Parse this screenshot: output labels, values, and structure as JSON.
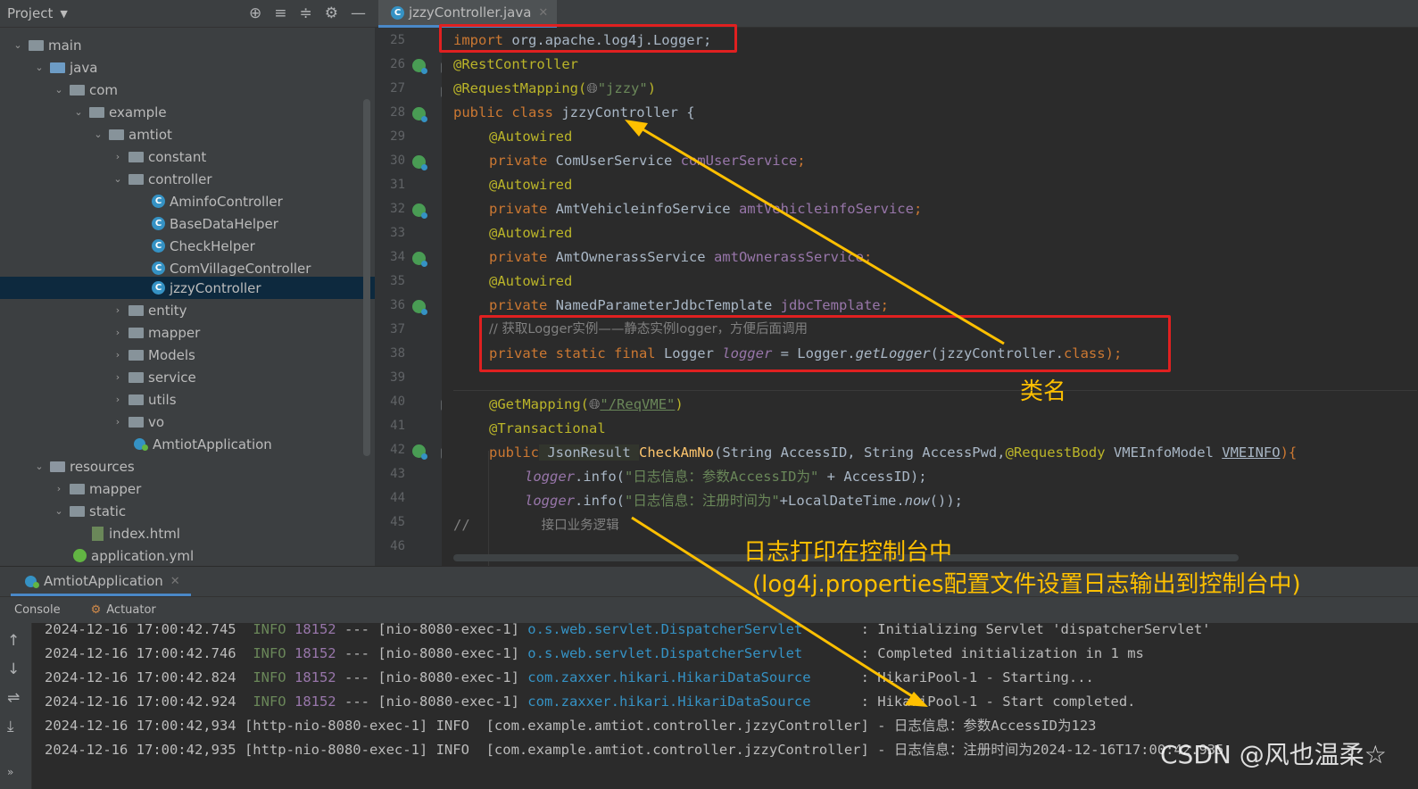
{
  "project_panel": {
    "title": "Project",
    "tree": [
      {
        "label": "main"
      },
      {
        "label": "java"
      },
      {
        "label": "com"
      },
      {
        "label": "example"
      },
      {
        "label": "amtiot"
      },
      {
        "label": "constant"
      },
      {
        "label": "controller"
      },
      {
        "label": "AminfoController"
      },
      {
        "label": "BaseDataHelper"
      },
      {
        "label": "CheckHelper"
      },
      {
        "label": "ComVillageController"
      },
      {
        "label": "jzzyController"
      },
      {
        "label": "entity"
      },
      {
        "label": "mapper"
      },
      {
        "label": "Models"
      },
      {
        "label": "service"
      },
      {
        "label": "utils"
      },
      {
        "label": "vo"
      },
      {
        "label": "AmtiotApplication"
      },
      {
        "label": "resources"
      },
      {
        "label": "mapper"
      },
      {
        "label": "static"
      },
      {
        "label": "index.html"
      },
      {
        "label": "application.yml"
      }
    ]
  },
  "editor": {
    "tab_label": "jzzyController.java",
    "line_numbers": [
      "25",
      "26",
      "27",
      "28",
      "29",
      "30",
      "31",
      "32",
      "33",
      "34",
      "35",
      "36",
      "37",
      "38",
      "39",
      "40",
      "41",
      "42",
      "43",
      "44",
      "45",
      "46"
    ],
    "lines": {
      "l25": {
        "a": "import",
        "b": " org.apache.log4j.Logger;"
      },
      "l26": "@RestController",
      "l27": {
        "a": "@RequestMapping(",
        "b": "\"jzzy\"",
        "c": ")"
      },
      "l28": {
        "a": "public class",
        "b": " jzzyController {"
      },
      "l29": "@Autowired",
      "l30": {
        "a": "private",
        "b": " ComUserService ",
        "c": "comUserService",
        "d": ";"
      },
      "l31": "@Autowired",
      "l32": {
        "a": "private",
        "b": " AmtVehicleinfoService ",
        "c": "amtVehicleinfoService",
        "d": ";"
      },
      "l33": "@Autowired",
      "l34": {
        "a": "private",
        "b": " AmtOwnerassService ",
        "c": "amtOwnerassService",
        "d": ";"
      },
      "l35": "@Autowired",
      "l36": {
        "a": "private",
        "b": " NamedParameterJdbcTemplate ",
        "c": "jdbcTemplate",
        "d": ";"
      },
      "l37": "// 获取Logger实例——静态实例logger，方便后面调用",
      "l38": {
        "a": "private static final",
        "b": " Logger ",
        "c": "logger",
        "d": " = Logger.",
        "e": "getLogger",
        "f": "(jzzyController.",
        "g": "class",
        "h": ");"
      },
      "l40": {
        "a": "@GetMapping(",
        "b": "\"/ReqVME\"",
        "c": ")"
      },
      "l41": "@Transactional",
      "l42": {
        "a": "public",
        "b": " JsonResult ",
        "c": "CheckAmNo",
        "d": "(String AccessID, String AccessPwd,",
        "e": "@RequestBody",
        "f": " VMEInfoModel ",
        "g": "VMEINFO",
        "h": "){"
      },
      "l43": {
        "a": "logger",
        "b": ".info(",
        "c": "\"日志信息：参数AccessID为\"",
        "d": " + AccessID);"
      },
      "l44": {
        "a": "logger",
        "b": ".info(",
        "c": "\"日志信息：注册时间为\"",
        "d": "+LocalDateTime.",
        "e": "now",
        "f": "());"
      },
      "l45": {
        "a": "//",
        "b": "接口业务逻辑"
      }
    }
  },
  "annotations": {
    "class_name": "类名",
    "console_line1": "日志打印在控制台中",
    "console_line2": "(log4j.properties配置文件设置日志输出到控制台中)"
  },
  "run_panel": {
    "tab_label": "AmtiotApplication",
    "subtabs": {
      "console": "Console",
      "actuator": "Actuator"
    },
    "log_lines": [
      {
        "ts": "2024-12-16 17:00:42.745",
        "lvl": "INFO",
        "pid": "18152",
        "mid": " --- [nio-8080-exec-1] ",
        "cls": "o.s.web.servlet.DispatcherServlet",
        "msg": "       : Initializing Servlet 'dispatcherServlet'"
      },
      {
        "ts": "2024-12-16 17:00:42.746",
        "lvl": "INFO",
        "pid": "18152",
        "mid": " --- [nio-8080-exec-1] ",
        "cls": "o.s.web.servlet.DispatcherServlet",
        "msg": "       : Completed initialization in 1 ms"
      },
      {
        "ts": "2024-12-16 17:00:42.824",
        "lvl": "INFO",
        "pid": "18152",
        "mid": " --- [nio-8080-exec-1] ",
        "cls": "com.zaxxer.hikari.HikariDataSource",
        "msg": "      : HikariPool-1 - Starting..."
      },
      {
        "ts": "2024-12-16 17:00:42.924",
        "lvl": "INFO",
        "pid": "18152",
        "mid": " --- [nio-8080-exec-1] ",
        "cls": "com.zaxxer.hikari.HikariDataSource",
        "msg": "      : HikariPool-1 - Start completed."
      }
    ],
    "log4j_lines": [
      "2024-12-16 17:00:42,934 [http-nio-8080-exec-1] INFO  [com.example.amtiot.controller.jzzyController] - 日志信息：参数AccessID为123",
      "2024-12-16 17:00:42,935 [http-nio-8080-exec-1] INFO  [com.example.amtiot.controller.jzzyController] - 日志信息：注册时间为2024-12-16T17:00:42.935"
    ]
  },
  "watermark": "CSDN @风也温柔☆",
  "colors": {
    "annotation": "#ffc000",
    "highlight_box": "#e02020"
  }
}
